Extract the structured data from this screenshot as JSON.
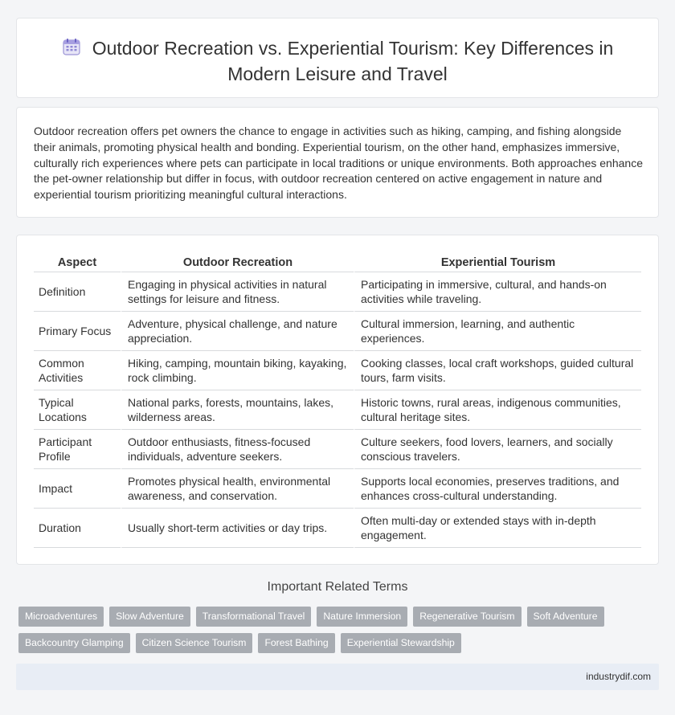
{
  "header": {
    "title": "Outdoor Recreation vs. Experiential Tourism: Key Differences in Modern Leisure and Travel",
    "icon": "calendar-icon"
  },
  "intro": {
    "text": "Outdoor recreation offers pet owners the chance to engage in activities such as hiking, camping, and fishing alongside their animals, promoting physical health and bonding. Experiential tourism, on the other hand, emphasizes immersive, culturally rich experiences where pets can participate in local traditions or unique environments. Both approaches enhance the pet-owner relationship but differ in focus, with outdoor recreation centered on active engagement in nature and experiential tourism prioritizing meaningful cultural interactions."
  },
  "table": {
    "headers": [
      "Aspect",
      "Outdoor Recreation",
      "Experiential Tourism"
    ],
    "rows": [
      [
        "Definition",
        "Engaging in physical activities in natural settings for leisure and fitness.",
        "Participating in immersive, cultural, and hands-on activities while traveling."
      ],
      [
        "Primary Focus",
        "Adventure, physical challenge, and nature appreciation.",
        "Cultural immersion, learning, and authentic experiences."
      ],
      [
        "Common Activities",
        "Hiking, camping, mountain biking, kayaking, rock climbing.",
        "Cooking classes, local craft workshops, guided cultural tours, farm visits."
      ],
      [
        "Typical Locations",
        "National parks, forests, mountains, lakes, wilderness areas.",
        "Historic towns, rural areas, indigenous communities, cultural heritage sites."
      ],
      [
        "Participant Profile",
        "Outdoor enthusiasts, fitness-focused individuals, adventure seekers.",
        "Culture seekers, food lovers, learners, and socially conscious travelers."
      ],
      [
        "Impact",
        "Promotes physical health, environmental awareness, and conservation.",
        "Supports local economies, preserves traditions, and enhances cross-cultural understanding."
      ],
      [
        "Duration",
        "Usually short-term activities or day trips.",
        "Often multi-day or extended stays with in-depth engagement."
      ]
    ]
  },
  "related": {
    "title": "Important Related Terms",
    "row1": [
      "Microadventures",
      "Slow Adventure",
      "Transformational Travel",
      "Nature Immersion",
      "Regenerative Tourism",
      "Soft Adventure"
    ],
    "row2": [
      "Backcountry Glamping",
      "Citizen Science Tourism",
      "Forest Bathing",
      "Experiential Stewardship"
    ]
  },
  "footer": {
    "site": "industrydif.com"
  },
  "colors": {
    "tag_bg": "#a8acb2",
    "footer_bg": "#e8edf5",
    "page_bg": "#f4f5f7"
  }
}
